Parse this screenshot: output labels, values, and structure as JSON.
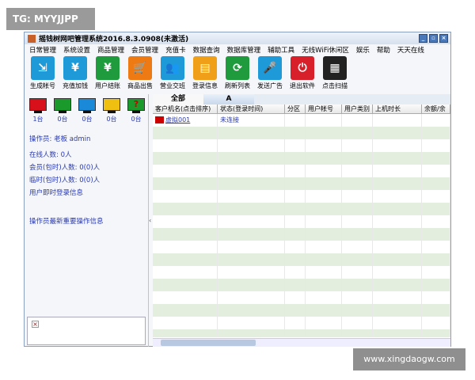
{
  "watermarks": {
    "top": "TG: MYYJJPP",
    "bottom": "www.xingdaogw.com"
  },
  "window": {
    "title": "摇钱树网吧管理系统2016.8.3.0908(未激活)"
  },
  "menu": [
    "日常管理",
    "系统设置",
    "商品管理",
    "会员管理",
    "充值卡",
    "数据查询",
    "数据库管理",
    "辅助工具",
    "无线WiFi休闲区",
    "娱乐",
    "帮助",
    "天天在线"
  ],
  "toolbar": [
    {
      "label": "生成帐号",
      "icon": "account-icon",
      "color": "#1e9ad8",
      "glyph": "⇲"
    },
    {
      "label": "充值加钱",
      "icon": "recharge-icon",
      "color": "#1e9ad8",
      "glyph": "¥"
    },
    {
      "label": "用户结账",
      "icon": "checkout-icon",
      "color": "#1f9a3c",
      "glyph": "¥"
    },
    {
      "label": "商品出售",
      "icon": "cart-icon",
      "color": "#ee7a14",
      "glyph": "🛒"
    },
    {
      "label": "营业交班",
      "icon": "users-icon",
      "color": "#1e9ad8",
      "glyph": "👥"
    },
    {
      "label": "登录信息",
      "icon": "id-card-icon",
      "color": "#f0a018",
      "glyph": "▤"
    },
    {
      "label": "刷新列表",
      "icon": "refresh-icon",
      "color": "#1f9a3c",
      "glyph": "⟳"
    },
    {
      "label": "发送广告",
      "icon": "microphone-icon",
      "color": "#1e9ad8",
      "glyph": "🎤"
    },
    {
      "label": "退出软件",
      "icon": "power-icon",
      "color": "#d8202a",
      "glyph": "⏻"
    },
    {
      "label": "点击扫描",
      "icon": "qr-code-icon",
      "color": "#222222",
      "glyph": "▦"
    }
  ],
  "status_monitors": [
    {
      "color": "#d8101a",
      "count": "1台",
      "glyph": ""
    },
    {
      "color": "#1a9a2a",
      "count": "0台",
      "glyph": ""
    },
    {
      "color": "#1a8ad8",
      "count": "0台",
      "glyph": ""
    },
    {
      "color": "#f0c010",
      "count": "0台",
      "glyph": ""
    },
    {
      "color": "#1a9a2a",
      "count": "0台",
      "glyph": "?"
    }
  ],
  "left": {
    "operator": "操作员: 老板 admin",
    "online": "在线人数: 0人",
    "member": "会员(包时)人数: 0(0)人",
    "temp": "临时(包时)人数: 0(0)人",
    "login_info": "用户即时登录信息",
    "operator_info": "操作员最新重要操作信息"
  },
  "tabs": [
    "全部",
    "A"
  ],
  "columns": [
    "客户机名(点击排序)",
    "状态(登录时间)",
    "分区",
    "用户帐号",
    "用户类别",
    "上机时长",
    "余额/余"
  ],
  "rows": [
    [
      "虚拟001",
      "未连接",
      "",
      "",
      "",
      "",
      ""
    ]
  ]
}
